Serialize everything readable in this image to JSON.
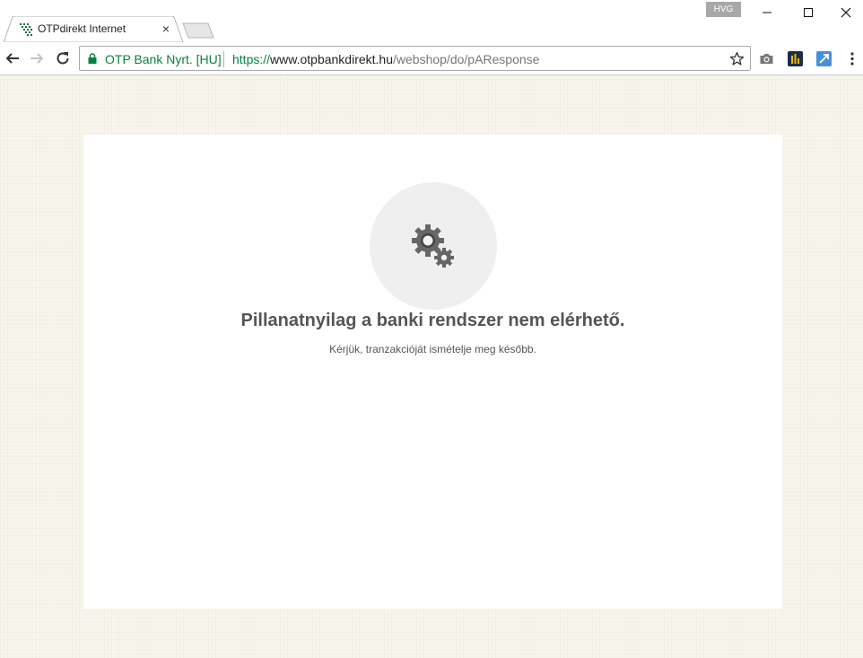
{
  "browser": {
    "tab_title": "OTPdirekt Internet",
    "tab_close": "×",
    "profile_badge": "HVG",
    "site_identity": "OTP Bank Nyrt. [HU]",
    "url_scheme": "https://",
    "url_host": "www.otpbankdirekt.hu",
    "url_path": "/webshop/do/pAResponse"
  },
  "page": {
    "error_title": "Pillanatnyilag a banki rendszer nem elérhető.",
    "error_subtitle": "Kérjük, tranzakcióját ismételje meg később.",
    "icon": "gears-icon"
  },
  "colors": {
    "secure_green": "#0b8043",
    "page_background": "#f8f6ec",
    "card_background": "#ffffff",
    "icon_circle": "#efefef",
    "text_gray": "#555555"
  }
}
